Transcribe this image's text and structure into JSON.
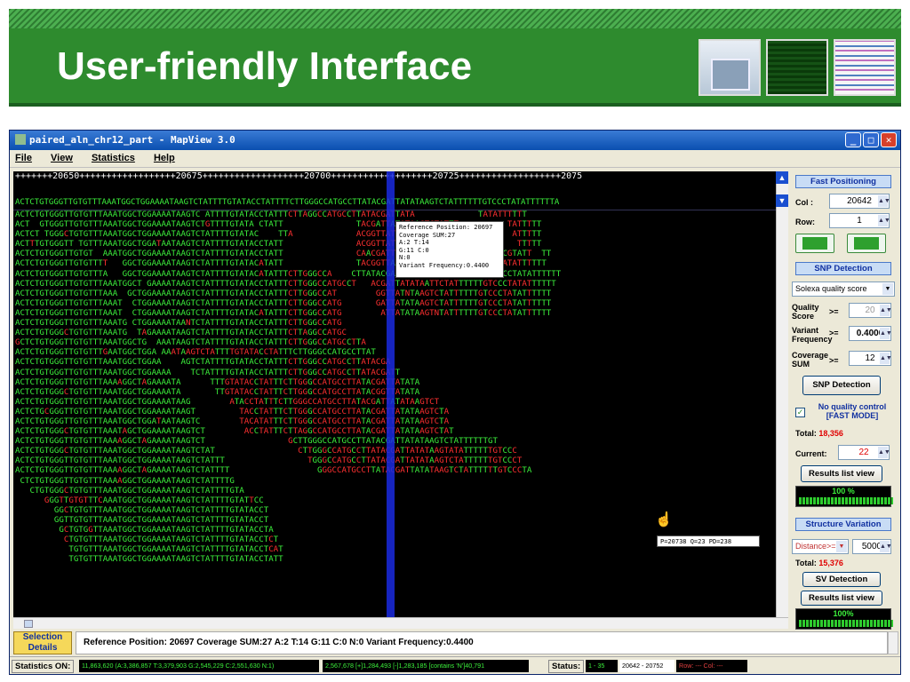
{
  "slide": {
    "title": "User-friendly Interface"
  },
  "window": {
    "title": "paired_aln_chr12_part - MapView 3.0"
  },
  "menu": {
    "file": "File",
    "view": "View",
    "statistics": "Statistics",
    "help": "Help"
  },
  "ruler_text": "+++++++20650++++++++++++++++++20675+++++++++++++++++++20700+++++++++++++++++++20725+++++++++++++++++++2075",
  "reference_seq": "ACTCTGTGGGTTGTGTTTAAATGGCTGGAAAATAAGTCTATTTTGTATACCTATTTTCTTGGGCCATGCCTTATACGATTATATAAGTCTATTTTTTGTCCCTATATTTTTTA",
  "reads": [
    "ACTCTGTGGGTTGTGTTTAAATGGCTGGAAAATAAGTC ATTTTGTATACCTATTTCTTAGGCCATGCCTTATACGATTATA             TATATTTTTT",
    "ACT  GTGGGTTGTGTTTAAATGGCTGGAAAATAAGTCTGTTTTGTATA CTATT               TACGATTATATAAGTCTATTT          TATTTTT",
    "ACTCT TGGGCTGTGTTTAAATGGCTGGAAAATAAGTCTATTTTGTATAC    TTA             ACGGTTATATAAGTCTATTTTTTG        ATTTTT",
    "ACTTTGTGGGTT TGTTTAAATGGCTGGATAATAAGTCTATTTTGTATACCTATT               ACGGTTATATAAGTCTATTTTTTGTCCC     TTTTT",
    "ACTCTGTGGGTTGTGT  AAATGGCTGGAAAATAAGTCTATTTTGTATACCTATT               CAACGATTATATAAGTCTATTTTTTGTCCCCGTATT  TT",
    "ACTCTGTGGGTTGTGTTTT   GGCTGGAAAATAAGTCTATTTTGTATACATATT               TACGGTTATATAAGTCTATTTTTTATCCCTATATTTTTT",
    "ACTCTGTGGGTTGTGTTTA   GGCTGGAAAATAAGTCTATTTTGTATACATATTTCTTGGGCCA    CTTATACGATTATATAAGTCTATTTTTTGTCCCTATATTTTTT",
    "ACTCTGTGGGTTGTGTTTAAATGGCT GAAAATAAGTCTATTTTGTATACCTATTTCTTGGGCCATGCCT   ACGATTATATAATTCTATTTTTTGTCCCTATATTTTTT",
    "ACTCTGTGGGTTGTGTTTAAA  GCTGGAAAATAAGTCTATTTTGTATACCTATTTCTTGGGCCAT        GGTTATNTAAGTCTATTTTTTGTCCCTATATTTTTT",
    "ACTCTGTGGGTTGTGTTTAAAT  CTGGAAAATAAGTCTATTTTGTATACCTATTTCTTGGGCCATG       GATTATATAAGTCTATTTTTTGTCCCTATATTTTTT",
    "ACTCTGTGGGTTGTGTTTAAAT  CTGGAAAATAAGTCTATTTTGTATACATATTTCTTGGGCCATG        ATTATATAAGTNTATTTTTTGTCCCTATATTTTTT",
    "ACTCTGTGGGTTGTGTTTAAATG CTGGAAAATAANTCTATTTTGTATACCTATTTCTTGGGCCATG",
    "ACTCTGTGGGCTGTGTTTAAATG  TAGAAAATAAGTCTATTTTGTATACCTATTTCTTAGGCCATGC",
    "GCTCTGTGGGTTGTGTTTAAATGGCTG  AAATAAGTCTATTTTGTATACCTATTTCTTGGGCCATGCCTTA",
    "ACTCTGTGGGTTGTGTTTGAATGGCTGGA AAATAAGTCTATTTTGTATACCTATTTCTTGGGCCATGCCTTAT",
    "ACTCTGTGGGTTGTGTTTAAATGGCTGGAA    AGTCTATTTTGTATACCTATTTCTTGGGCCATGCCTTATACGA",
    "ACTCTGTGGGTTGTGTTTAAATGGCTGGAAAA    TCTATTTTGTATACCTATTTCTTGGGCCATGCCTTATACGATT",
    "ACTCTGTGGGTTGTGTTTAAAAGGCTAGAAAATA      TTTGTATACCTATTTCTTGGGCCATGCCTTATACGATTATATA",
    "ACTCTGTGGGCTGTGTTTAAATGGCTGGAAAATA       TTGTATACCTATTTCTTGGGCCATGCCTTATACGGTTATATA",
    "ACTCTGTGGGTTGTGTTTAAATGGCTGGAAAATAAG        ATACCTATTTCTTGGGCCATGCCTTATACGATTATATAAGTCT",
    "ACTCTGCGGGTTGTGTTTAAATGGCTGGAAAATAAGT         TACCTATTTCTTGGGCCATGCCTTATACGATTATATAAGTCTA",
    "ACTCTGTGGGTTGTGTTTAAATGGCTGGATAATAAGTC        TACATATTTCTTGGGCCATGCCTTATACGATTATATAAGTCTA",
    "ACTCTGTGGGCTGTGTTTAAATAGCTGGAAAATAAGTCT        ACCTATTTCTTAGGCCATGCCTTATACGATTATATAAGTCTAT",
    "ACTCTGTGGGTTGTGTTTAAAAGGCTAGAAAATAAGTCT                 GCTTGGGCCATGCCTTATACGATTATATAAGTCTATTTTTTGT",
    "ACTCTGTGGGCTGTGTTTAAATGGCTGGAAAATAAGTCTAT                 CTTGGGCCATGCCTTATACGATTATATAAGTATATTTTTTGTCCC",
    "ACTCTGTGGGTTGTGTTTAAATGGCTGGAAAATAAGTCTATTT                 TGGGCCATGCCTTATACGATTATATAAGTCTATTTTTTGTCCCT",
    "ACTCTGTGGGTTGTGTTTAAAAGGCTAGAAAATAAGTCTATTTT                  GGGCCATGCCTTATACGATTATATAAGTCTATTTTTTGTCCCTA",
    " CTCTGTGGGTTGTGTTTAAAAGGCTGGAAAATAAGTCTATTTTG",
    "   CTGTGGGCTGTGTTTAAATGGCTGGAAAATAAGTCTATTTTGTA",
    "      GGGTTGTGTTTCAAATGGCTGGAAAATAAGTCTATTTTGTATTCC",
    "        GGCTGTGTTTAAATGGCTGGAAAATAAGTCTATTTTGTATACCT",
    "        GGTTGTGTTTAAATGGCTGGAAAATAAGTCTATTTTGTATACCT",
    "         GCTGTGGTTAAATGGCTGGAAAATAAGTCTATTTTGTATACCTA",
    "          CTGTGTTTAAATGGCTGGAAAATAAGTCTATTTTGTATACCTCT",
    "           TGTGTTTAAATGGCTGGAAAATAAGTCTATTTTGTATACCTCAT",
    "           TGTGTTTAAATGGCTGGAAAATAAGTCTATTTTGTATACCTATT"
  ],
  "popup": {
    "line1": "Reference Position: 20697",
    "line2": "Coverage SUM:27",
    "line3": "A:2  T:14",
    "line4": "G:11  C:0",
    "line5": "N:0",
    "line6": "Variant Frequency:0.4400"
  },
  "hover_tip": "P=20738  Q=23  PD=238",
  "fast_positioning": {
    "header": "Fast Positioning",
    "col_label": "Col :",
    "col_value": "20642",
    "row_label": "Row:",
    "row_value": "1"
  },
  "snp": {
    "header": "SNP Detection",
    "mode": "Solexa quality score",
    "quality_label": "Quality Score",
    "op": ">=",
    "quality_value": "20",
    "variant_label": "Variant Frequency",
    "variant_value": "0.4000",
    "coverage_label": "Coverage SUM",
    "coverage_value": "12",
    "detect_button": "SNP Detection",
    "no_qc_label": "No quality control [FAST MODE]",
    "total_label": "Total:",
    "total_value": "18,356",
    "current_label": "Current:",
    "current_value": "22",
    "results_button": "Results list view",
    "progress_text": "100 %",
    "progress_fraction": 1.0
  },
  "sv": {
    "header": "Structure Variation",
    "distance_option": "Distance>=",
    "distance_value": "5000",
    "total_label": "Total:",
    "total_value": "15,376",
    "detect_button": "SV Detection",
    "results_button": "Results list view",
    "progress_text": "100%",
    "progress_fraction": 1.0
  },
  "selection": {
    "label": "Selection Details",
    "text": "Reference Position: 20697  Coverage SUM:27  A:2  T:14  G:11  C:0  N:0  Variant Frequency:0.4400"
  },
  "statusbar": {
    "stats_label": "Statistics ON:",
    "stats1": "11,863,620 (A:3,386,857 T:3,379,903 G:2,545,229 C:2,551,630 N:1)",
    "stats2": "2,567,678  [+]1,284,493  [-]1,283,185  [contains 'N']40,791",
    "status_label": "Status:",
    "status1": "1 - 35",
    "status2": "20642 - 20752",
    "status3": "Row: ---  Col: ---"
  },
  "colors": {
    "sequence": "#3cf03c",
    "mismatch": "#ff3030",
    "cursor": "#1a2ae0",
    "banner": "#2e8b2e"
  }
}
